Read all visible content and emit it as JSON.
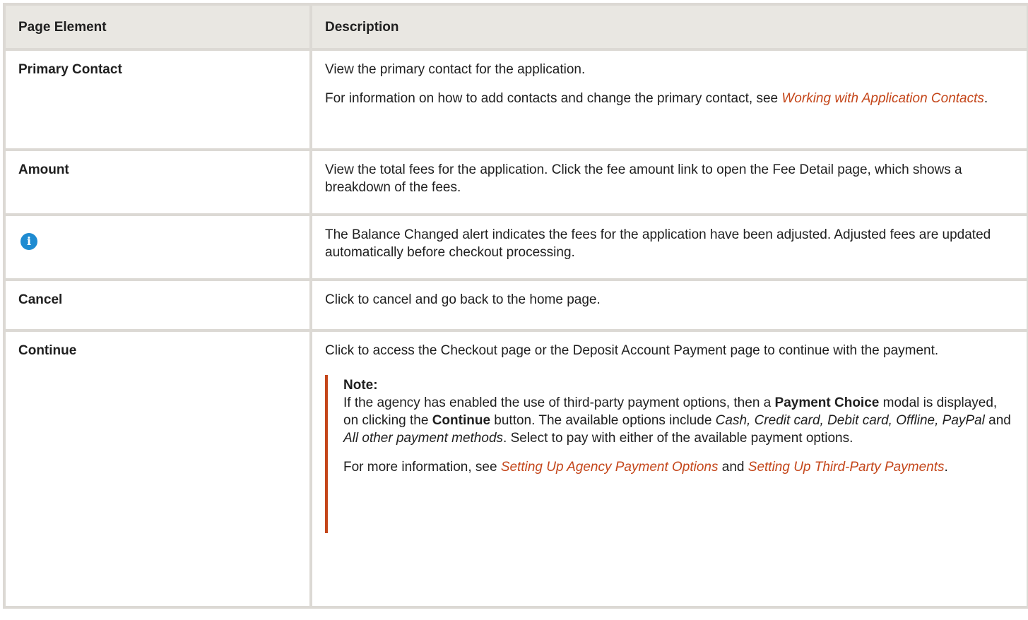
{
  "table": {
    "headers": [
      "Page Element",
      "Description"
    ],
    "rows": {
      "primary_contact": {
        "element": "Primary Contact",
        "desc1": "View the primary contact for the application.",
        "desc2_pre": "For information on how to add contacts and change the primary contact, see ",
        "desc2_link": "Working with Application Contacts",
        "desc2_post": "."
      },
      "amount": {
        "element": "Amount",
        "desc": "View the total fees for the application. Click the fee amount link to open the Fee Detail page, which shows a breakdown of the fees."
      },
      "balance_alert": {
        "icon": "info-icon",
        "icon_glyph": "i",
        "desc": "The Balance Changed alert indicates the fees for the application have been adjusted. Adjusted fees are updated automatically before checkout processing."
      },
      "cancel": {
        "element": "Cancel",
        "desc": "Click to cancel and go back to the home page."
      },
      "continue": {
        "element": "Continue",
        "desc": "Click to access the Checkout page or the Deposit Account Payment page to continue with the payment.",
        "note": {
          "title": "Note:",
          "p1_a": "If the agency has enabled the use of third-party payment options, then a ",
          "p1_b": "Payment Choice",
          "p1_c": " modal is displayed, on clicking the ",
          "p1_d": "Continue",
          "p1_e": " button. The available options include ",
          "p1_f": "Cash, Credit card, Debit card, Offline, PayPal",
          "p1_g": " and ",
          "p1_h": "All other payment methods",
          "p1_i": ". Select to pay with either of the available payment options.",
          "p2_a": "For more information, see ",
          "p2_link1": "Setting Up Agency Payment Options",
          "p2_b": " and ",
          "p2_link2": "Setting Up Third-Party Payments",
          "p2_c": "."
        }
      }
    }
  },
  "colors": {
    "link": "#c4461a",
    "header_bg": "#e9e7e2",
    "border": "#dcd9d4",
    "info_icon": "#1e8bd1"
  }
}
